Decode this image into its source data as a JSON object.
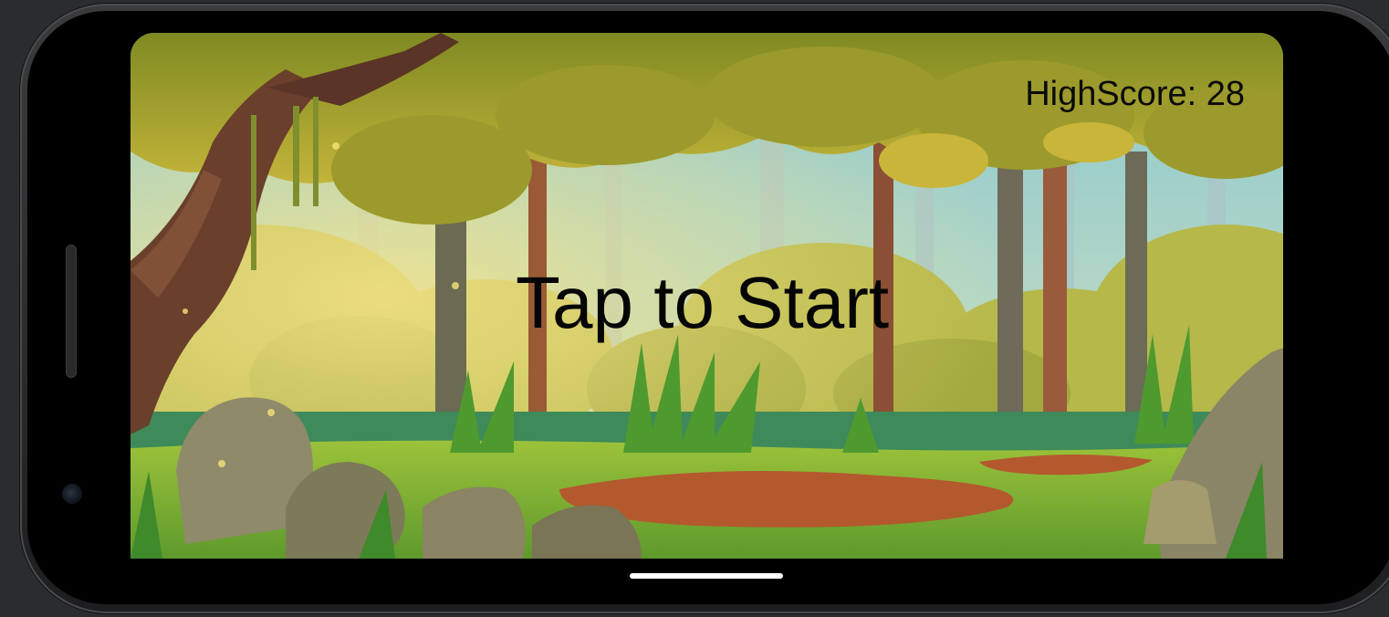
{
  "game": {
    "highscore_text": "HighScore: 28",
    "start_prompt": "Tap to Start"
  },
  "device": {
    "frame_color": "#000000",
    "gesture_bar_color": "#ffffff"
  },
  "scene": {
    "setting": "forest",
    "sky_color": "#9fd1d4",
    "canopy_color": "#b9b33a",
    "grass_color": "#7fae2f",
    "path_color": "#b4582e"
  }
}
